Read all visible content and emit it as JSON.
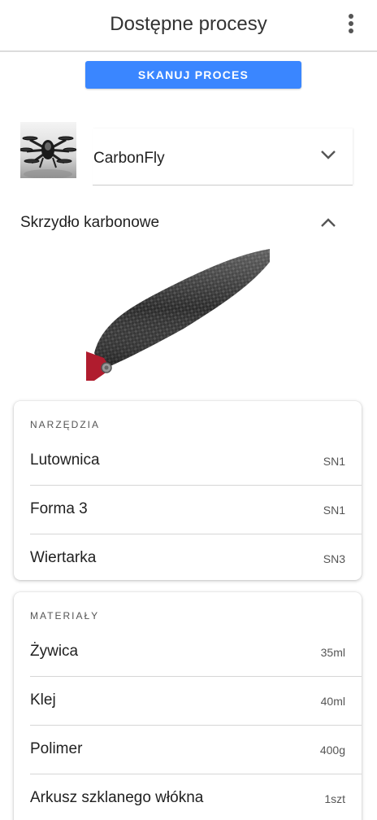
{
  "appbar": {
    "title": "Dostępne procesy",
    "menu_icon": "more-vertical-icon"
  },
  "scan_button": {
    "label": "SKANUJ PROCES"
  },
  "product": {
    "selected": "CarbonFly",
    "thumbnail_icon": "drone-image"
  },
  "section": {
    "title": "Skrzydło karbonowe",
    "image": "carbon-propeller-image"
  },
  "tools": {
    "header": "NARZĘDZIA",
    "items": [
      {
        "name": "Lutownica",
        "code": "SN1"
      },
      {
        "name": "Forma 3",
        "code": "SN1"
      },
      {
        "name": "Wiertarka",
        "code": "SN3"
      }
    ]
  },
  "materials": {
    "header": "MATERIAŁY",
    "items": [
      {
        "name": "Żywica",
        "amount": "35ml"
      },
      {
        "name": "Klej",
        "amount": "40ml"
      },
      {
        "name": "Polimer",
        "amount": "400g"
      },
      {
        "name": "Arkusz szklanego włókna",
        "amount": "1szt"
      }
    ]
  },
  "colors": {
    "accent": "#3a86ff",
    "text": "#212121",
    "secondary": "#555555"
  }
}
